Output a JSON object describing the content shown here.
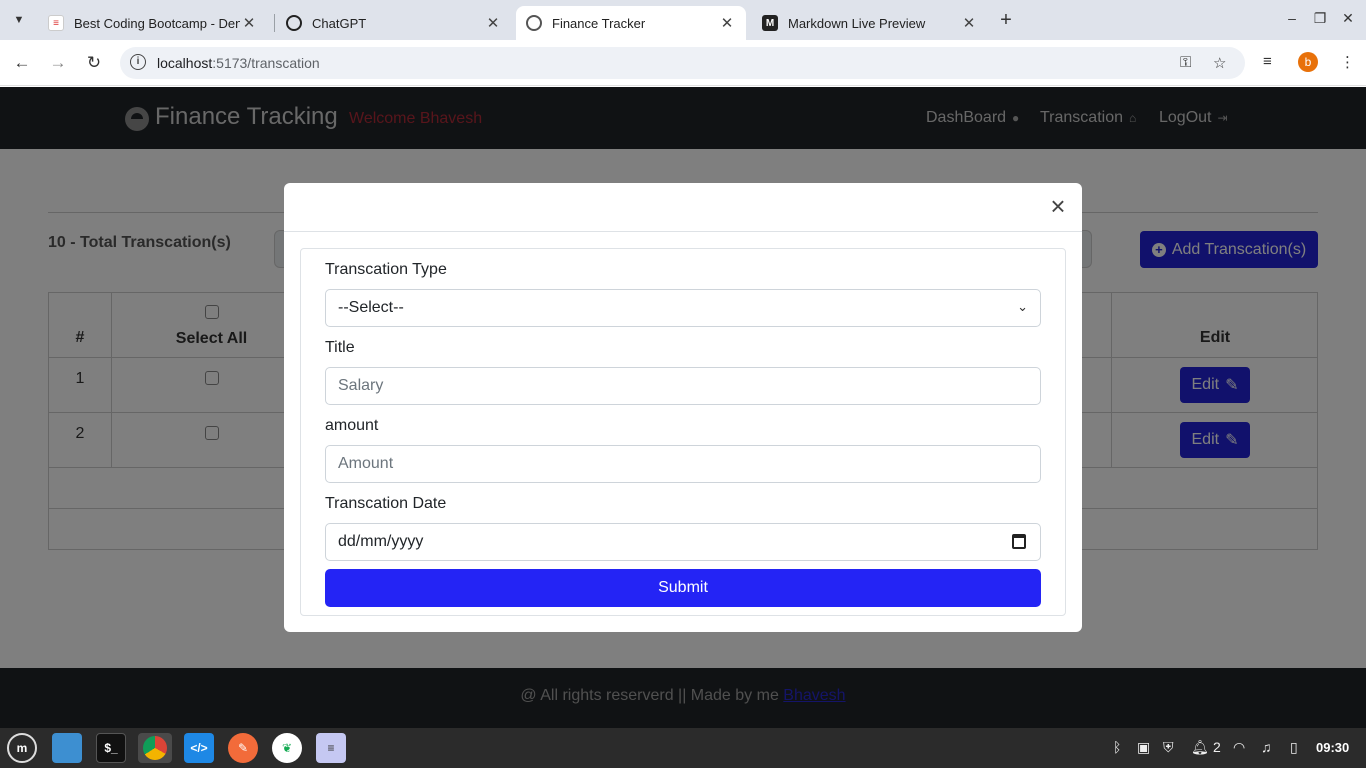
{
  "browser": {
    "tabs": [
      {
        "title": "Best Coding Bootcamp - Den",
        "favicon": "bootcamp-icon"
      },
      {
        "title": "ChatGPT",
        "favicon": "chatgpt-icon"
      },
      {
        "title": "Finance Tracker",
        "favicon": "globe-icon",
        "active": true
      },
      {
        "title": "Markdown Live Preview",
        "favicon": "m-icon"
      }
    ],
    "url_host": "localhost",
    "url_path": ":5173/transcation",
    "profile_initial": "b"
  },
  "navbar": {
    "brand": "Finance Tracking",
    "welcome": "Welcome Bhavesh",
    "links": [
      {
        "label": "DashBoard",
        "icon": "circle-icon"
      },
      {
        "label": "Transcation",
        "icon": "bank-icon"
      },
      {
        "label": "LogOut",
        "icon": "logout-icon"
      }
    ]
  },
  "page": {
    "total_label": "10 - Total Transcation(s)",
    "add_button": "Add Transcation(s)",
    "table": {
      "headers": {
        "num": "#",
        "select_all": "Select All",
        "edit": "Edit"
      },
      "rows": [
        {
          "num": "1",
          "edit": "Edit"
        },
        {
          "num": "2",
          "edit": "Edit"
        }
      ]
    }
  },
  "modal": {
    "close": "×",
    "type_label": "Transcation Type",
    "type_value": "--Select--",
    "title_label": "Title",
    "title_placeholder": "Salary",
    "amount_label": "amount",
    "amount_placeholder": "Amount",
    "date_label": "Transcation Date",
    "date_placeholder": "dd/mm/yyyy",
    "submit": "Submit"
  },
  "footer": {
    "text": "@ All rights reserverd || Made by me ",
    "link": "Bhavesh"
  },
  "taskbar": {
    "notification_count": "2",
    "clock": "09:30"
  },
  "colors": {
    "primary": "#2424f5",
    "navbar_bg": "#212529",
    "welcome": "#b02a37"
  }
}
